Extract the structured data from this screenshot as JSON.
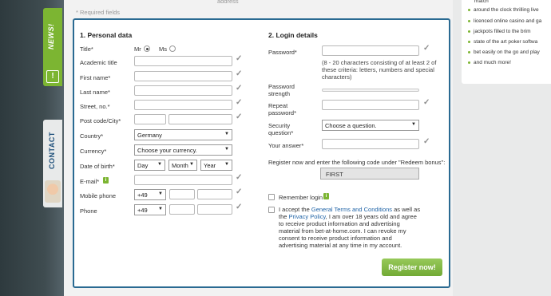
{
  "header": {
    "address_text": "address",
    "required_note": "* Required fields"
  },
  "tabs": {
    "news": "NEWS!",
    "contact": "CONTACT"
  },
  "personal": {
    "title": "1. Personal data",
    "title_label": "Title*",
    "mr": "Mr",
    "ms": "Ms",
    "academic_title": "Academic title",
    "first_name": "First name*",
    "last_name": "Last name*",
    "street": "Street, no.*",
    "post_code": "Post code/City*",
    "country_label": "Country*",
    "country_value": "Germany",
    "currency_label": "Currency*",
    "currency_value": "Choose your currency.",
    "dob_label": "Date of birth*",
    "day": "Day",
    "month": "Month",
    "year": "Year",
    "email_label": "E-mail*",
    "info_icon_text": "i",
    "mobile_label": "Mobile phone",
    "mobile_prefix": "+49",
    "phone_label": "Phone",
    "phone_prefix": "+49"
  },
  "login": {
    "title": "2. Login details",
    "password_label": "Password*",
    "password_help": "(8 - 20 characters consisting of at least 2 of these criteria: letters, numbers and special characters)",
    "strength_label": "Password strength",
    "repeat_label": "Repeat password*",
    "security_label": "Security question*",
    "security_value": "Choose a question.",
    "answer_label": "Your answer*",
    "bonus_text": "Register now and enter the following code under \"Redeem bonus\":",
    "bonus_code": "FIRST",
    "remember_label": "Remember login",
    "terms_1": "I accept the",
    "terms_link1": "General Terms and Conditions",
    "terms_2": "as well as the",
    "terms_link2": "Privacy Policy",
    "terms_3": ", I am over 18 years old and agree to receive product information and advertising material from bet-at-home.com. I can revoke my consent to receive product information and advertising material at any time in my account.",
    "register_button": "Register now!"
  },
  "right_panel": {
    "items": [
      "match",
      "around the clock thrilling live",
      "licenced online casino and ga",
      "jackpots filled to the brim",
      "state of the art poker softwa",
      "bet easily on the go and play",
      "and much more!"
    ]
  },
  "check_mark": "✓",
  "dropdown_arrow": "▼",
  "colors": {
    "accent_green": "#7cb532",
    "frame_blue": "#2a6a92",
    "link_blue": "#1f63a6"
  }
}
